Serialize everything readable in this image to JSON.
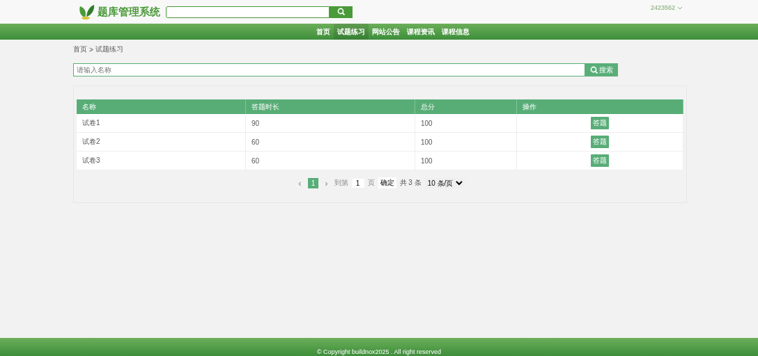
{
  "header": {
    "logo_text": "题库管理系统",
    "user": "2423562"
  },
  "nav": [
    {
      "label": "首页",
      "selected": false
    },
    {
      "label": "试题练习",
      "selected": true
    },
    {
      "label": "网站公告",
      "selected": false
    },
    {
      "label": "课程资讯",
      "selected": false
    },
    {
      "label": "课程信息",
      "selected": false
    }
  ],
  "breadcrumb": {
    "items": [
      "首页",
      "试题练习"
    ],
    "separator": ">"
  },
  "search": {
    "placeholder": "请输入名称",
    "button": "搜索"
  },
  "table": {
    "columns": [
      "名称",
      "答题时长",
      "总分",
      "操作"
    ],
    "rows": [
      {
        "cells": [
          "试卷1",
          "90",
          "100"
        ],
        "action": "答题"
      },
      {
        "cells": [
          "试卷2",
          "60",
          "100"
        ],
        "action": "答题"
      },
      {
        "cells": [
          "试卷3",
          "60",
          "100"
        ],
        "action": "答题"
      }
    ]
  },
  "pagination": {
    "prev": "‹",
    "pages": [
      {
        "label": "1",
        "selected": true
      }
    ],
    "next": "›",
    "goto_label": "到第",
    "page_value": "1",
    "page_unit": "页",
    "confirm": "确定",
    "total": "共 3 条",
    "page_size": "10 条/页"
  },
  "footer": "© Copyright buildnox2025 . All right reserved"
}
